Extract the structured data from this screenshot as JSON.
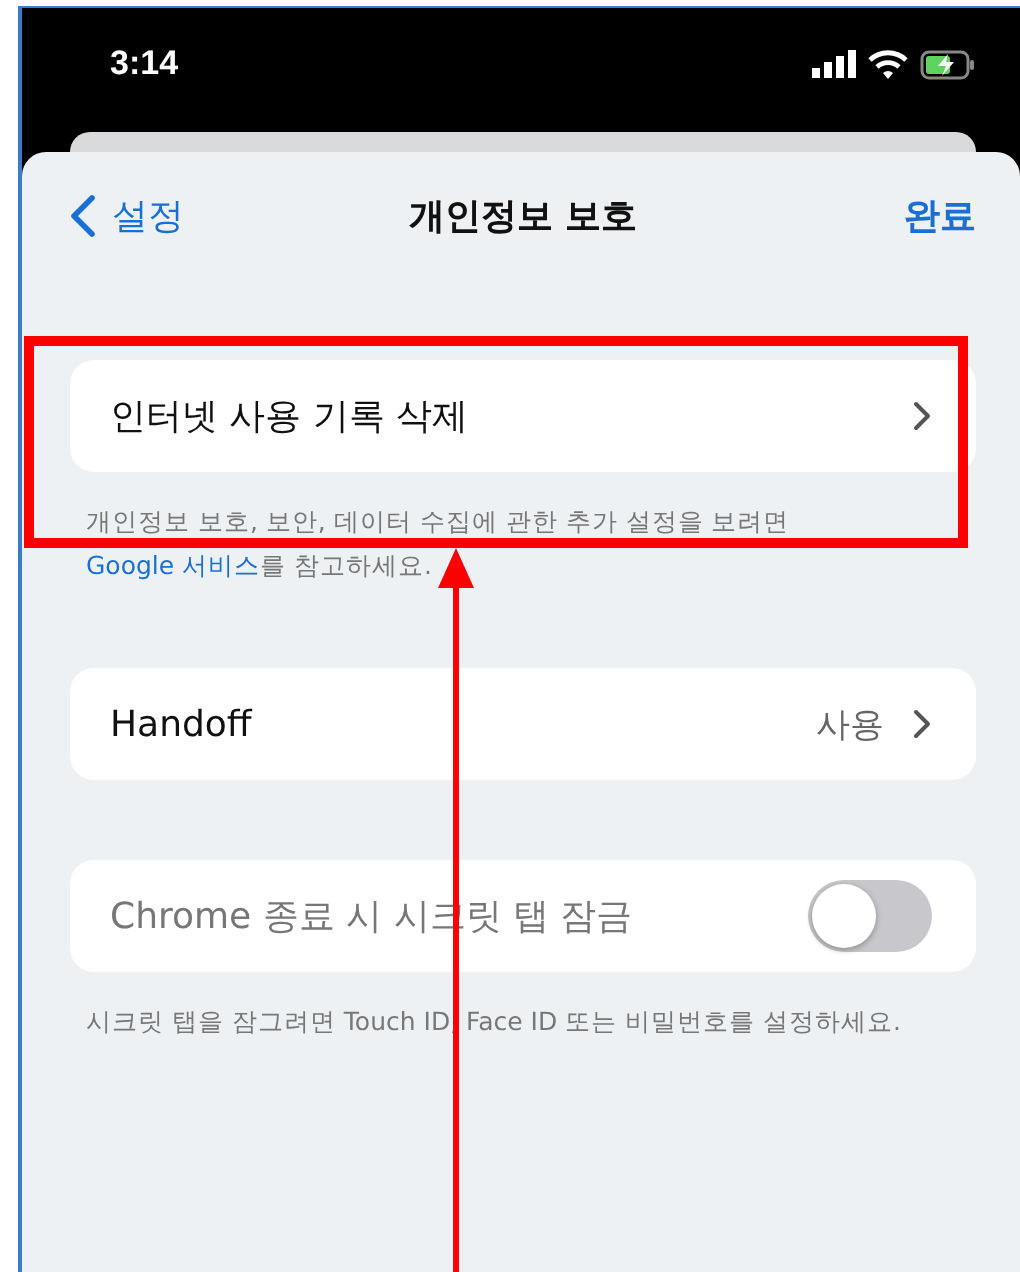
{
  "status_bar": {
    "time": "3:14"
  },
  "nav": {
    "back_label": "설정",
    "title": "개인정보 보호",
    "done": "완료"
  },
  "groups": [
    {
      "items": [
        {
          "kind": "link",
          "label": "인터넷 사용 기록 삭제",
          "disabled": false
        }
      ],
      "footer": {
        "text": "개인정보 보호, 보안, 데이터 수집에 관한 추가 설정을 보려면 ",
        "link": "Google 서비스",
        "after": "를 참고하세요."
      }
    },
    {
      "items": [
        {
          "kind": "value",
          "label": "Handoff",
          "value": "사용",
          "disabled": false
        }
      ]
    },
    {
      "items": [
        {
          "kind": "toggle",
          "label": "Chrome 종료 시 시크릿 탭 잠금",
          "on": false,
          "disabled": true
        }
      ],
      "footer": {
        "text": "시크릿 탭을 잠그려면 Touch ID, Face ID 또는 비밀번호를 설정하세요."
      }
    }
  ]
}
